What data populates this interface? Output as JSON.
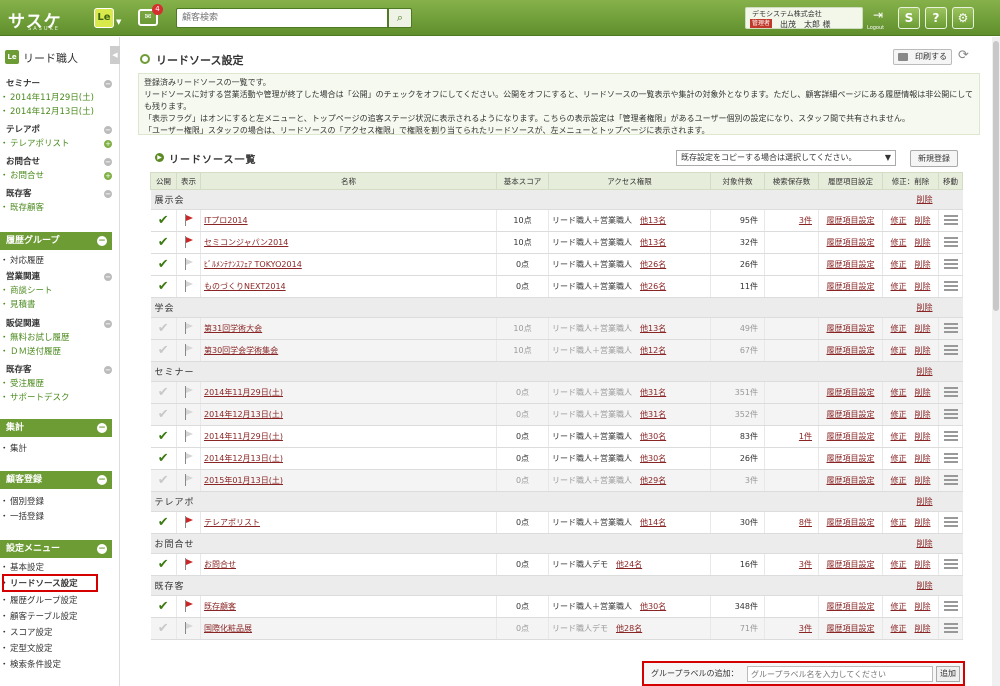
{
  "header": {
    "logo": "サスケ",
    "logo_sub": "SASUKE",
    "le_label": "Le",
    "message_count": "4",
    "search_placeholder": "顧客検索",
    "company": "デモシステム株式会社",
    "role_badge": "管理者",
    "user_name": "出茂　太郎 様",
    "logout_label": "Logout"
  },
  "sidebar": {
    "app_label": "Le",
    "title": "リード職人",
    "groups": [
      {
        "label": "セミナー",
        "items": [
          "2014年11月29日(土)",
          "2014年12月13日(土)"
        ]
      },
      {
        "label": "テレアポ",
        "items": [
          "テレアポリスト"
        ]
      },
      {
        "label": "お問合せ",
        "items": [
          "お問合せ"
        ]
      },
      {
        "label": "既存客",
        "items": [
          "既存顧客"
        ]
      }
    ],
    "history_group": {
      "title": "履歴グループ",
      "top": "対応履歴",
      "groups": [
        {
          "label": "営業関連",
          "items": [
            "商談シート",
            "見積書"
          ]
        },
        {
          "label": "販促関連",
          "items": [
            "無料お試し履歴",
            "ＤＭ送付履歴"
          ]
        },
        {
          "label": "既存客",
          "items": [
            "受注履歴",
            "サポートデスク"
          ]
        }
      ]
    },
    "aggregate": {
      "title": "集計",
      "items": [
        "集計"
      ]
    },
    "customer_reg": {
      "title": "顧客登録",
      "items": [
        "個別登録",
        "一括登録"
      ]
    },
    "settings": {
      "title": "設定メニュー",
      "items": [
        "基本設定",
        "リードソース設定",
        "履歴グループ設定",
        "顧客テーブル設定",
        "スコア設定",
        "定型文設定",
        "検索条件設定"
      ]
    }
  },
  "main": {
    "title": "リードソース設定",
    "print_label": "印刷する",
    "description": [
      "登録済みリードソースの一覧です。",
      "リードソースに対する営業活動や管理が終了した場合は「公開」のチェックをオフにしてください。公開をオフにすると、リードソースの一覧表示や集計の対象外となります。ただし、顧客詳細ページにある履歴情報は非公開にしても残ります。",
      "「表示フラグ」はオンにすると左メニューと、トップページの追客ステージ状況に表示されるようになります。こちらの表示設定は「管理者権限」があるユーザー個別の設定になり、スタッフ間で共有されません。",
      "「ユーザー権限」スタッフの場合は、リードソースの「アクセス権限」で権限を割り当てられたリードソースが、左メニューとトップページに表示されます。"
    ],
    "list_title": "リードソース一覧",
    "copy_select": "既存設定をコピーする場合は選択してください。",
    "new_button": "新規登録",
    "columns": [
      "公開",
      "表示",
      "名称",
      "基本スコア",
      "アクセス権限",
      "対象件数",
      "検索保存数",
      "履歴項目設定",
      "修正：削除",
      "移動"
    ],
    "group_delete_label": "削除",
    "history_link": "履歴項目設定",
    "edit_label": "修正",
    "delete_label": "削除",
    "groups": [
      {
        "name": "展示会",
        "rows": [
          {
            "pub": true,
            "disp": true,
            "name": "ITプロ2014",
            "score": "10点",
            "access": "リード職人＋営業職人",
            "staff": "他13名",
            "count": "95件",
            "saved": "3件"
          },
          {
            "pub": true,
            "disp": true,
            "name": "セミコンジャパン2014",
            "score": "10点",
            "access": "リード職人＋営業職人",
            "staff": "他13名",
            "count": "32件",
            "saved": ""
          },
          {
            "pub": true,
            "disp": false,
            "name": "ﾋﾞﾙﾒﾝﾃﾅﾝｽﾌｪｱ TOKYO2014",
            "score": "0点",
            "access": "リード職人＋営業職人",
            "staff": "他26名",
            "count": "26件",
            "saved": ""
          },
          {
            "pub": true,
            "disp": false,
            "name": "ものづくりNEXT2014",
            "score": "0点",
            "access": "リード職人＋営業職人",
            "staff": "他26名",
            "count": "11件",
            "saved": ""
          }
        ]
      },
      {
        "name": "学会",
        "rows": [
          {
            "pub": false,
            "disp": false,
            "name": "第31回学術大会",
            "score": "10点",
            "access": "リード職人＋営業職人",
            "staff": "他13名",
            "count": "49件",
            "saved": ""
          },
          {
            "pub": false,
            "disp": false,
            "name": "第30回学会学術集会",
            "score": "10点",
            "access": "リード職人＋営業職人",
            "staff": "他12名",
            "count": "67件",
            "saved": ""
          }
        ]
      },
      {
        "name": "セミナー",
        "rows": [
          {
            "pub": false,
            "disp": false,
            "name": "2014年11月29日(土)",
            "score": "0点",
            "access": "リード職人＋営業職人",
            "staff": "他31名",
            "count": "351件",
            "saved": ""
          },
          {
            "pub": false,
            "disp": false,
            "name": "2014年12月13日(土)",
            "score": "0点",
            "access": "リード職人＋営業職人",
            "staff": "他31名",
            "count": "352件",
            "saved": ""
          },
          {
            "pub": true,
            "disp": false,
            "name": "2014年11月29日(土)",
            "score": "0点",
            "access": "リード職人＋営業職人",
            "staff": "他30名",
            "count": "83件",
            "saved": "1件"
          },
          {
            "pub": true,
            "disp": false,
            "name": "2014年12月13日(土)",
            "score": "0点",
            "access": "リード職人＋営業職人",
            "staff": "他30名",
            "count": "26件",
            "saved": ""
          },
          {
            "pub": false,
            "disp": false,
            "name": "2015年01月13日(土)",
            "score": "0点",
            "access": "リード職人＋営業職人",
            "staff": "他29名",
            "count": "3件",
            "saved": ""
          }
        ]
      },
      {
        "name": "テレアポ",
        "rows": [
          {
            "pub": true,
            "disp": true,
            "name": "テレアポリスト",
            "score": "0点",
            "access": "リード職人＋営業職人",
            "staff": "他14名",
            "count": "30件",
            "saved": "8件"
          }
        ]
      },
      {
        "name": "お問合せ",
        "rows": [
          {
            "pub": true,
            "disp": true,
            "name": "お問合せ",
            "score": "0点",
            "access": "リード職人デモ",
            "staff": "他24名",
            "count": "16件",
            "saved": "3件"
          }
        ]
      },
      {
        "name": "既存客",
        "rows": [
          {
            "pub": true,
            "disp": true,
            "name": "既存顧客",
            "score": "0点",
            "access": "リード職人＋営業職人",
            "staff": "他30名",
            "count": "348件",
            "saved": ""
          },
          {
            "pub": false,
            "disp": false,
            "name": "国際化粧品展",
            "score": "0点",
            "access": "リード職人デモ",
            "staff": "他28名",
            "count": "71件",
            "saved": "3件"
          }
        ]
      }
    ],
    "add_group_label": "グループラベルの追加：",
    "add_group_placeholder": "グループラベル名を入力してください",
    "add_button": "追加"
  }
}
